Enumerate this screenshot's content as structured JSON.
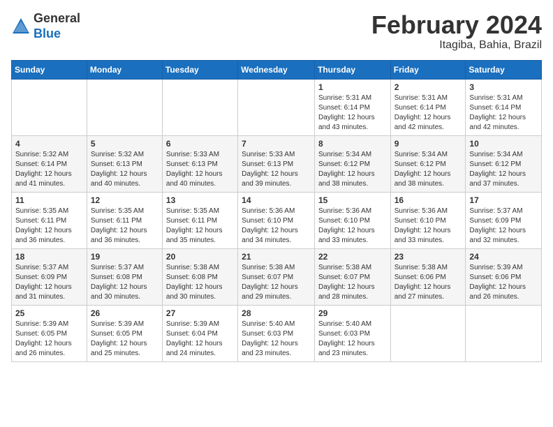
{
  "header": {
    "logo_general": "General",
    "logo_blue": "Blue",
    "month_title": "February 2024",
    "location": "Itagiba, Bahia, Brazil"
  },
  "days_of_week": [
    "Sunday",
    "Monday",
    "Tuesday",
    "Wednesday",
    "Thursday",
    "Friday",
    "Saturday"
  ],
  "weeks": [
    [
      {
        "day": "",
        "info": ""
      },
      {
        "day": "",
        "info": ""
      },
      {
        "day": "",
        "info": ""
      },
      {
        "day": "",
        "info": ""
      },
      {
        "day": "1",
        "info": "Sunrise: 5:31 AM\nSunset: 6:14 PM\nDaylight: 12 hours\nand 43 minutes."
      },
      {
        "day": "2",
        "info": "Sunrise: 5:31 AM\nSunset: 6:14 PM\nDaylight: 12 hours\nand 42 minutes."
      },
      {
        "day": "3",
        "info": "Sunrise: 5:31 AM\nSunset: 6:14 PM\nDaylight: 12 hours\nand 42 minutes."
      }
    ],
    [
      {
        "day": "4",
        "info": "Sunrise: 5:32 AM\nSunset: 6:14 PM\nDaylight: 12 hours\nand 41 minutes."
      },
      {
        "day": "5",
        "info": "Sunrise: 5:32 AM\nSunset: 6:13 PM\nDaylight: 12 hours\nand 40 minutes."
      },
      {
        "day": "6",
        "info": "Sunrise: 5:33 AM\nSunset: 6:13 PM\nDaylight: 12 hours\nand 40 minutes."
      },
      {
        "day": "7",
        "info": "Sunrise: 5:33 AM\nSunset: 6:13 PM\nDaylight: 12 hours\nand 39 minutes."
      },
      {
        "day": "8",
        "info": "Sunrise: 5:34 AM\nSunset: 6:12 PM\nDaylight: 12 hours\nand 38 minutes."
      },
      {
        "day": "9",
        "info": "Sunrise: 5:34 AM\nSunset: 6:12 PM\nDaylight: 12 hours\nand 38 minutes."
      },
      {
        "day": "10",
        "info": "Sunrise: 5:34 AM\nSunset: 6:12 PM\nDaylight: 12 hours\nand 37 minutes."
      }
    ],
    [
      {
        "day": "11",
        "info": "Sunrise: 5:35 AM\nSunset: 6:11 PM\nDaylight: 12 hours\nand 36 minutes."
      },
      {
        "day": "12",
        "info": "Sunrise: 5:35 AM\nSunset: 6:11 PM\nDaylight: 12 hours\nand 36 minutes."
      },
      {
        "day": "13",
        "info": "Sunrise: 5:35 AM\nSunset: 6:11 PM\nDaylight: 12 hours\nand 35 minutes."
      },
      {
        "day": "14",
        "info": "Sunrise: 5:36 AM\nSunset: 6:10 PM\nDaylight: 12 hours\nand 34 minutes."
      },
      {
        "day": "15",
        "info": "Sunrise: 5:36 AM\nSunset: 6:10 PM\nDaylight: 12 hours\nand 33 minutes."
      },
      {
        "day": "16",
        "info": "Sunrise: 5:36 AM\nSunset: 6:10 PM\nDaylight: 12 hours\nand 33 minutes."
      },
      {
        "day": "17",
        "info": "Sunrise: 5:37 AM\nSunset: 6:09 PM\nDaylight: 12 hours\nand 32 minutes."
      }
    ],
    [
      {
        "day": "18",
        "info": "Sunrise: 5:37 AM\nSunset: 6:09 PM\nDaylight: 12 hours\nand 31 minutes."
      },
      {
        "day": "19",
        "info": "Sunrise: 5:37 AM\nSunset: 6:08 PM\nDaylight: 12 hours\nand 30 minutes."
      },
      {
        "day": "20",
        "info": "Sunrise: 5:38 AM\nSunset: 6:08 PM\nDaylight: 12 hours\nand 30 minutes."
      },
      {
        "day": "21",
        "info": "Sunrise: 5:38 AM\nSunset: 6:07 PM\nDaylight: 12 hours\nand 29 minutes."
      },
      {
        "day": "22",
        "info": "Sunrise: 5:38 AM\nSunset: 6:07 PM\nDaylight: 12 hours\nand 28 minutes."
      },
      {
        "day": "23",
        "info": "Sunrise: 5:38 AM\nSunset: 6:06 PM\nDaylight: 12 hours\nand 27 minutes."
      },
      {
        "day": "24",
        "info": "Sunrise: 5:39 AM\nSunset: 6:06 PM\nDaylight: 12 hours\nand 26 minutes."
      }
    ],
    [
      {
        "day": "25",
        "info": "Sunrise: 5:39 AM\nSunset: 6:05 PM\nDaylight: 12 hours\nand 26 minutes."
      },
      {
        "day": "26",
        "info": "Sunrise: 5:39 AM\nSunset: 6:05 PM\nDaylight: 12 hours\nand 25 minutes."
      },
      {
        "day": "27",
        "info": "Sunrise: 5:39 AM\nSunset: 6:04 PM\nDaylight: 12 hours\nand 24 minutes."
      },
      {
        "day": "28",
        "info": "Sunrise: 5:40 AM\nSunset: 6:03 PM\nDaylight: 12 hours\nand 23 minutes."
      },
      {
        "day": "29",
        "info": "Sunrise: 5:40 AM\nSunset: 6:03 PM\nDaylight: 12 hours\nand 23 minutes."
      },
      {
        "day": "",
        "info": ""
      },
      {
        "day": "",
        "info": ""
      }
    ]
  ]
}
